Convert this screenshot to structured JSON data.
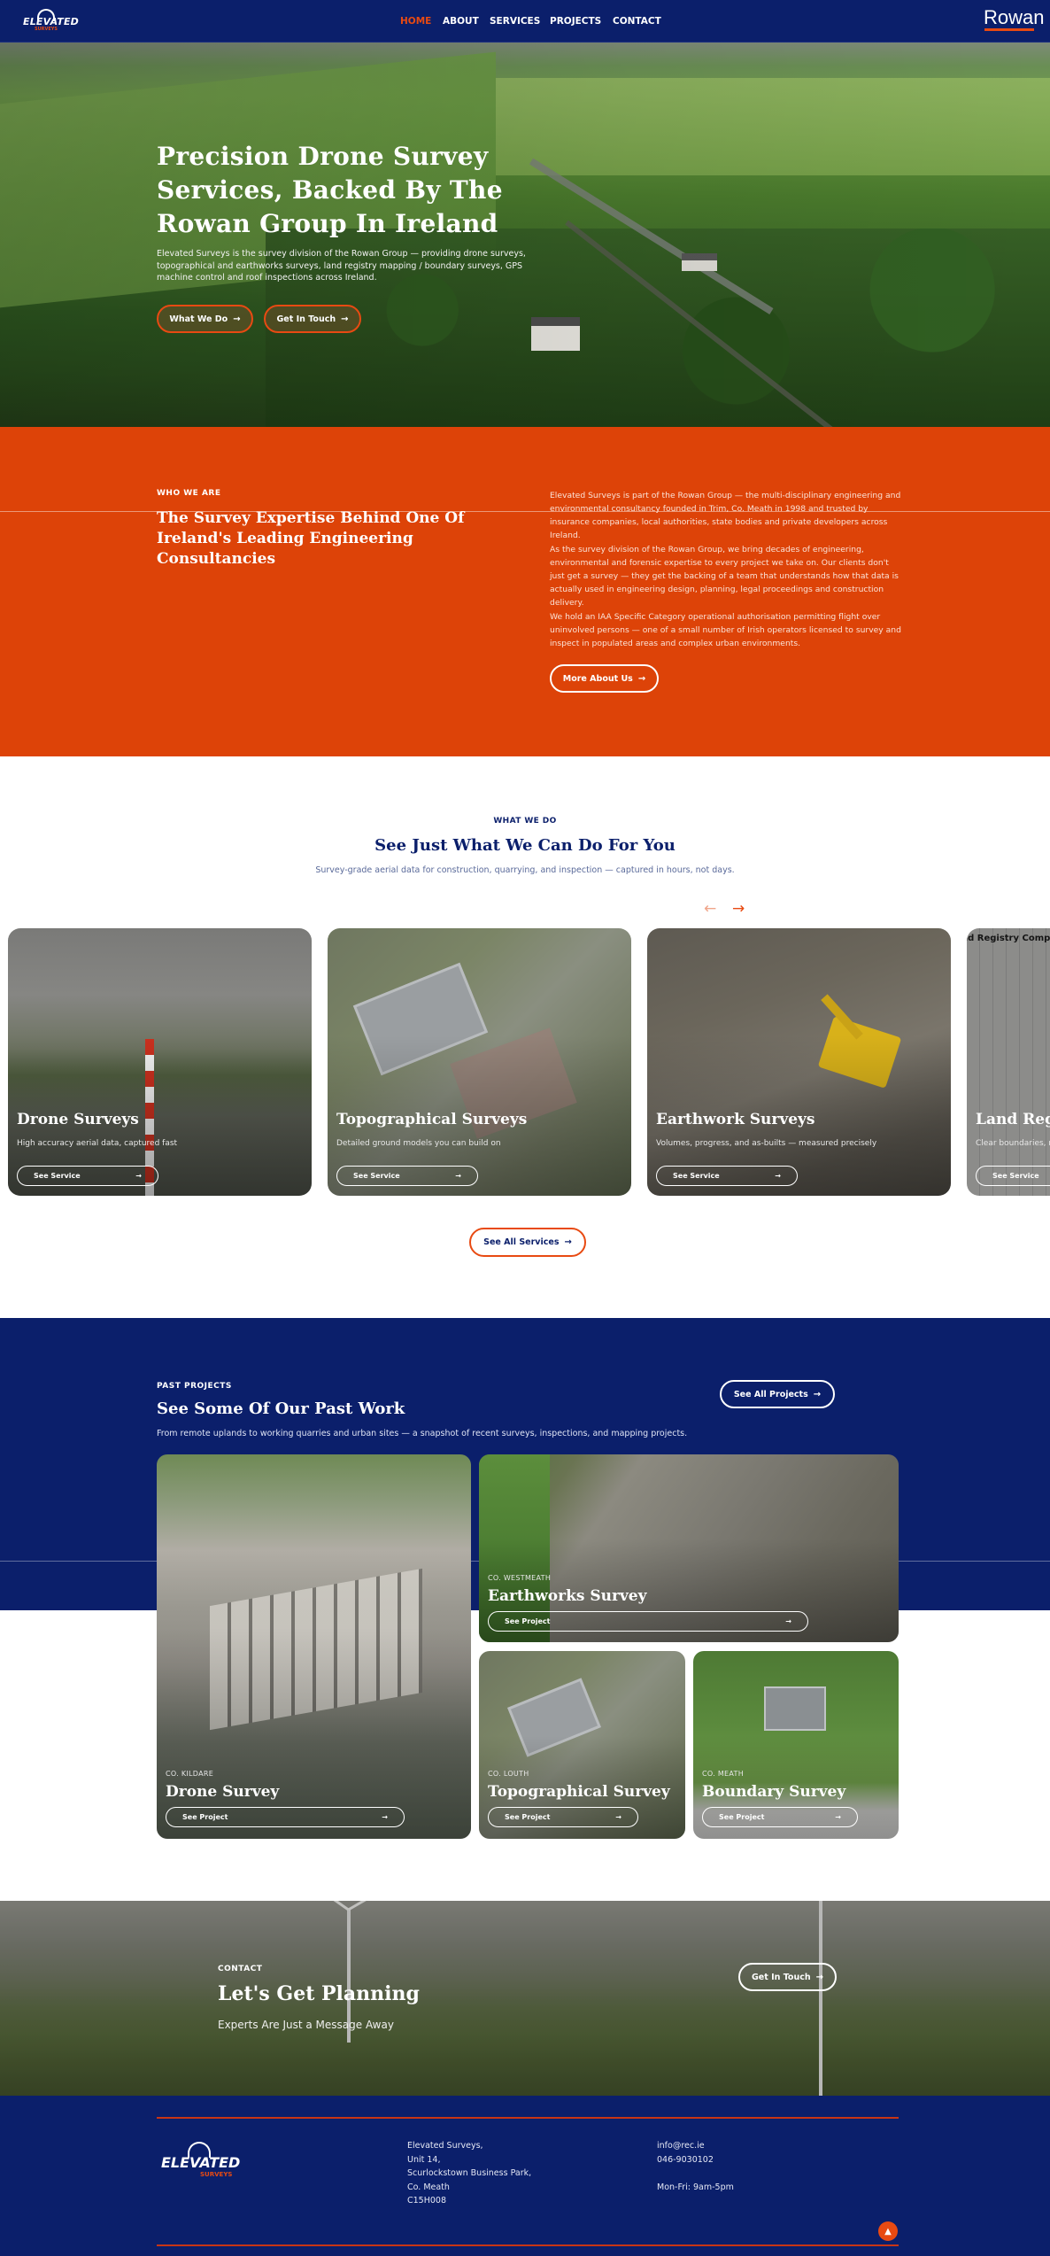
{
  "nav": {
    "logo_text": "ELEVATED",
    "logo_sub": "SURVEYS",
    "items": [
      {
        "label": "HOME",
        "active": true
      },
      {
        "label": "ABOUT",
        "active": false
      },
      {
        "label": "SERVICES",
        "active": false
      },
      {
        "label": "PROJECTS",
        "active": false
      },
      {
        "label": "CONTACT",
        "active": false
      }
    ],
    "partner_logo": "Rowan"
  },
  "hero": {
    "title": "Precision Drone Survey Services, Backed By The Rowan Group In Ireland",
    "body": "Elevated Surveys is the survey division of the Rowan Group — providing drone surveys, topographical and earthworks surveys, land registry mapping / boundary surveys, GPS machine control and roof inspections across Ireland.",
    "buttons": [
      {
        "label": "What We Do",
        "icon": "arrow-right-icon"
      },
      {
        "label": "Get In Touch",
        "icon": "arrow-right-icon"
      }
    ]
  },
  "who": {
    "eyebrow": "WHO WE ARE",
    "title": "The Survey Expertise Behind One Of Ireland's Leading Engineering Consultancies",
    "paragraphs": [
      "Elevated Surveys is part of the Rowan Group — the multi-disciplinary engineering and environmental consultancy founded in Trim, Co. Meath in 1998 and trusted by insurance companies, local authorities, state bodies and private developers across Ireland.",
      "As the survey division of the Rowan Group, we bring decades of engineering, environmental and forensic expertise to every project we take on. Our clients don't just get a survey — they get the backing of a team that understands how that data is actually used in engineering design, planning, legal proceedings and construction delivery.",
      "We hold an IAA Specific Category operational authorisation permitting flight over uninvolved persons — one of a small number of Irish operators licensed to survey and inspect in populated areas and complex urban environments."
    ],
    "button": "More About Us"
  },
  "services": {
    "eyebrow": "WHAT WE DO",
    "title": "See Just What We Can Do For You",
    "subtitle": "Survey-grade aerial data for construction, quarrying, and inspection — captured in hours, not days.",
    "prev_icon": "arrow-left-icon",
    "next_icon": "arrow-right-icon",
    "cards": [
      {
        "title": "Drone Surveys",
        "desc": "High accuracy aerial data, captured fast",
        "button": "See Service"
      },
      {
        "title": "Topographical Surveys",
        "desc": "Detailed ground models you can build on",
        "button": "See Service"
      },
      {
        "title": "Earthwork Surveys",
        "desc": "Volumes, progress, and as-builts — measured precisely",
        "button": "See Service"
      },
      {
        "title": "Land Registry Compliant",
        "desc": "Clear boundaries, m",
        "button": "See Service",
        "map_label": "nd Registry Compl"
      }
    ],
    "all_button": "See All Services"
  },
  "projects": {
    "eyebrow": "PAST PROJECTS",
    "title": "See Some Of Our Past Work",
    "subtitle": "From remote uplands to working quarries and urban sites — a snapshot of recent surveys, inspections, and mapping projects.",
    "all_button": "See All Projects",
    "cards": [
      {
        "location": "CO. KILDARE",
        "title": "Drone Survey",
        "button": "See Project"
      },
      {
        "location": "CO. WESTMEATH",
        "title": "Earthworks Survey",
        "button": "See Project"
      },
      {
        "location": "CO. LOUTH",
        "title": "Topographical Survey",
        "button": "See Project"
      },
      {
        "location": "CO. MEATH",
        "title": "Boundary Survey",
        "button": "See Project"
      }
    ]
  },
  "contact": {
    "eyebrow": "CONTACT",
    "title": "Let's Get Planning",
    "subtitle": "Experts Are Just a Message Away",
    "button": "Get In Touch"
  },
  "footer": {
    "logo_text": "ELEVATED",
    "logo_sub": "SURVEYS",
    "address": [
      "Elevated Surveys,",
      "Unit 14,",
      "Scurlockstown Business Park,",
      "Co. Meath",
      "C15H008"
    ],
    "email": "info@rec.ie",
    "phone": "046-9030102",
    "hours": "Mon-Fri: 9am-5pm",
    "to_top_icon": "chevron-up-icon"
  },
  "colors": {
    "navy": "#0b1f6b",
    "orange": "#dd4308",
    "accent": "#e84a12"
  }
}
